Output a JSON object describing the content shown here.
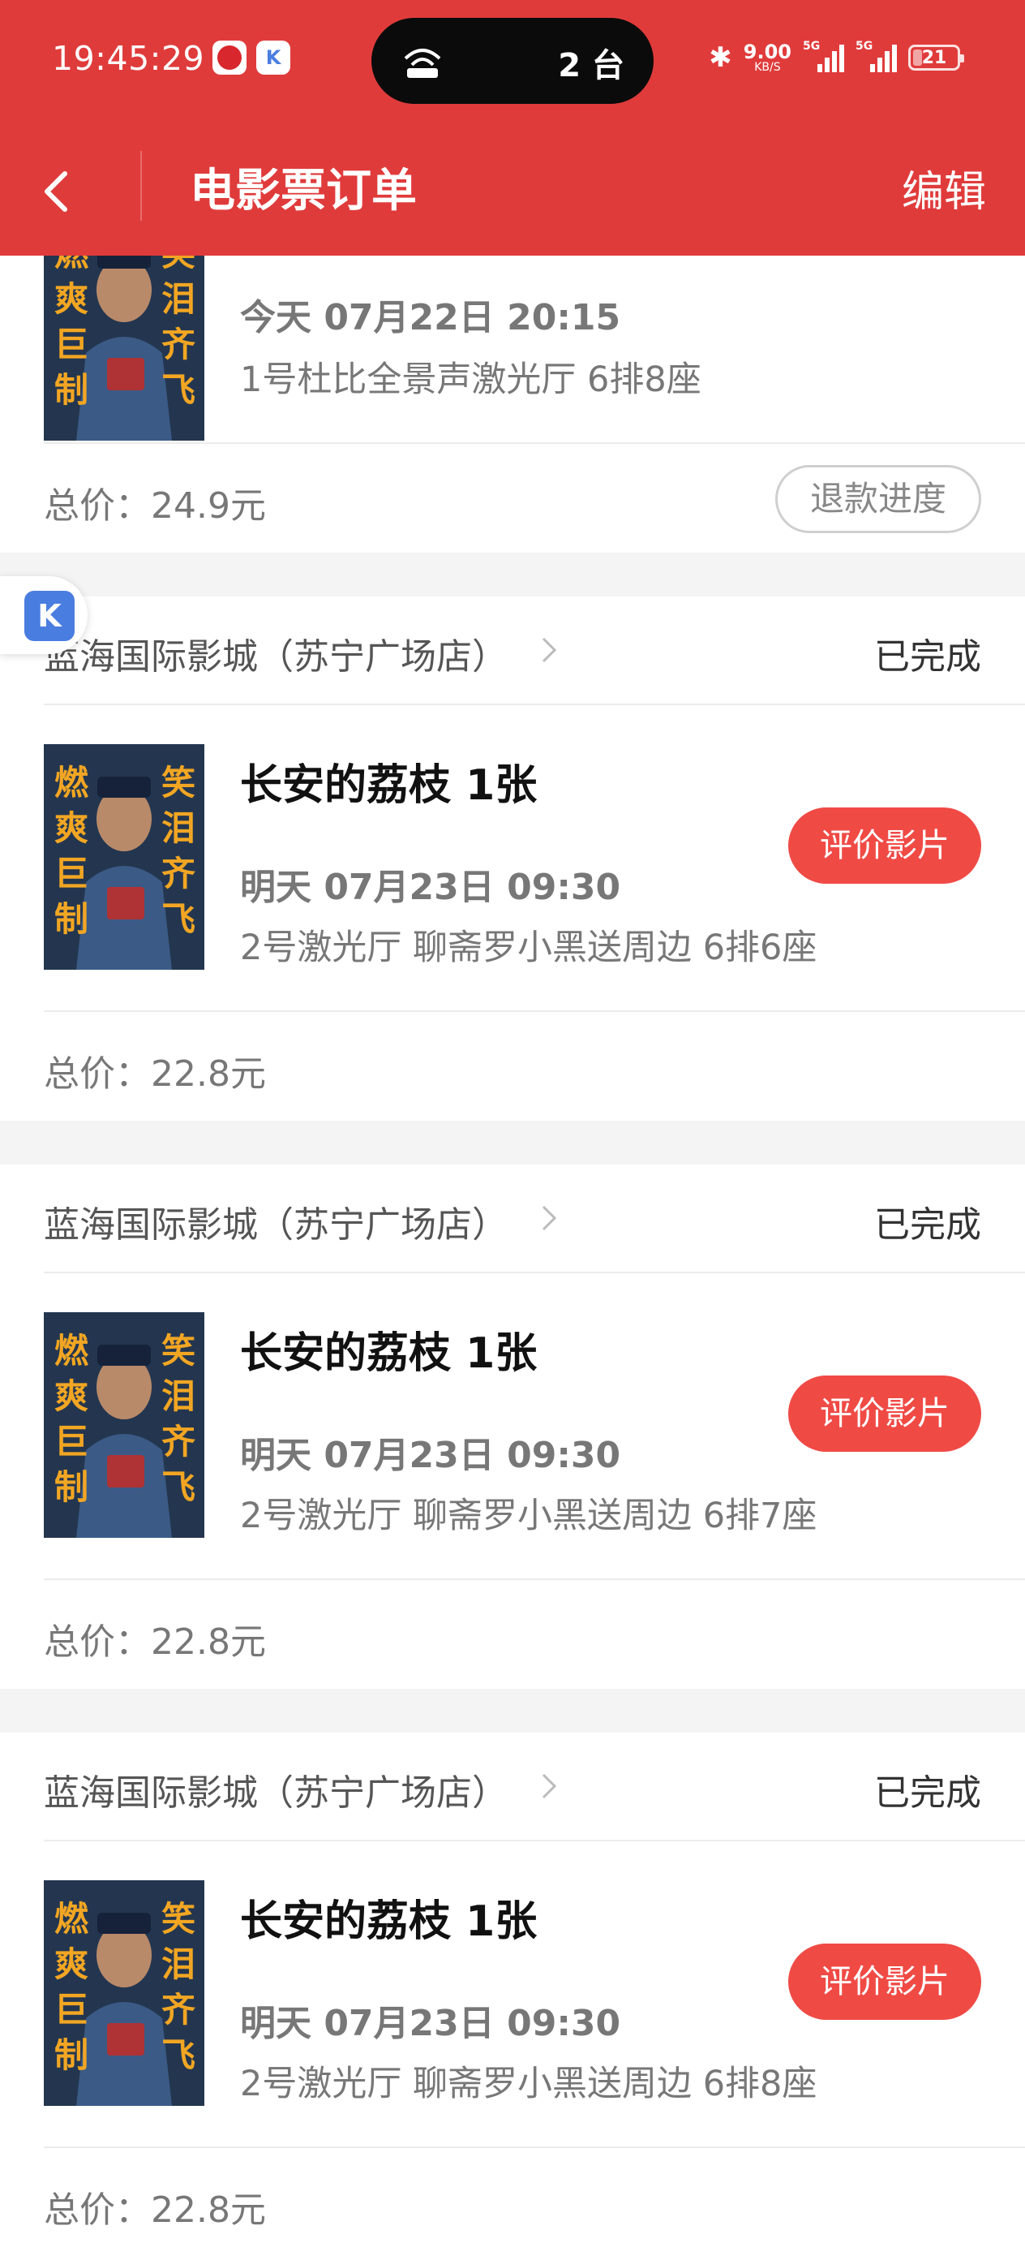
{
  "status_bar": {
    "time": "19:45:29",
    "island_text": "2 台",
    "net_speed_value": "9.00",
    "net_speed_unit": "KB/S",
    "signal_1_tag": "5G",
    "signal_2_tag": "5G",
    "battery_level": 21,
    "battery_text": "21"
  },
  "nav": {
    "title": "电影票订单",
    "edit_label": "编辑"
  },
  "poster": {
    "left_chars": [
      "燃",
      "爽",
      "巨",
      "制"
    ],
    "right_chars": [
      "笑",
      "泪",
      "齐",
      "飞"
    ],
    "colors": {
      "bg": "#24364f",
      "text": "#f2a623",
      "accent": "#c42b27"
    }
  },
  "orders": [
    {
      "show_time": "今天 07月22日 20:15",
      "hall_seat": "1号杜比全景声激光厅 6排8座",
      "total": "总价：24.9元",
      "action": "退款进度"
    },
    {
      "cinema": "蓝海国际影城（苏宁广场店）",
      "status": "已完成",
      "title": "长安的荔枝 1张",
      "show_time": "明天 07月23日 09:30",
      "hall_seat": "2号激光厅 聊斋罗小黑送周边 6排6座",
      "action": "评价影片",
      "total": "总价：22.8元"
    },
    {
      "cinema": "蓝海国际影城（苏宁广场店）",
      "status": "已完成",
      "title": "长安的荔枝 1张",
      "show_time": "明天 07月23日 09:30",
      "hall_seat": "2号激光厅 聊斋罗小黑送周边 6排7座",
      "action": "评价影片",
      "total": "总价：22.8元"
    },
    {
      "cinema": "蓝海国际影城（苏宁广场店）",
      "status": "已完成",
      "title": "长安的荔枝 1张",
      "show_time": "明天 07月23日 09:30",
      "hall_seat": "2号激光厅 聊斋罗小黑送周边 6排8座",
      "action": "评价影片",
      "total": "总价：22.8元"
    }
  ],
  "floating_widget": {
    "icon": "k-app-icon",
    "label": "K"
  },
  "colors": {
    "header_red": "#e03b3b",
    "button_red": "#f04a45",
    "text_gray": "#777777"
  }
}
